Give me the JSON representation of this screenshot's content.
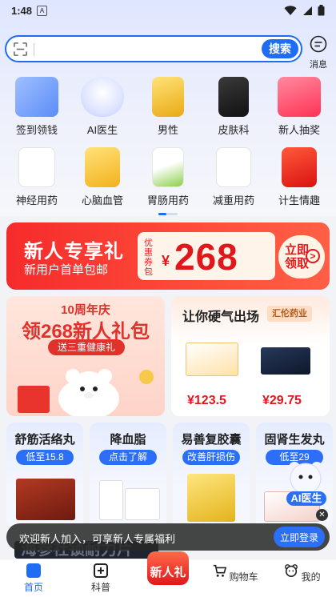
{
  "status": {
    "time": "1:48",
    "app_glyph": "A"
  },
  "search": {
    "placeholder": "",
    "button": "搜索"
  },
  "message": {
    "label": "消息"
  },
  "categories": [
    {
      "label": "签到领钱",
      "icon": "calendar-icon",
      "color": "#6ea0ff"
    },
    {
      "label": "AI医生",
      "icon": "ai-bear-doctor-icon",
      "color": "#cfd8ff"
    },
    {
      "label": "男性",
      "icon": "medicine-box-icon",
      "color": "#f2c230"
    },
    {
      "label": "皮肤科",
      "icon": "medicine-box-icon",
      "color": "#2a2a2a"
    },
    {
      "label": "新人抽奖",
      "icon": "gift-box-icon",
      "color": "#ff4a6a"
    },
    {
      "label": "神经用药",
      "icon": "medicine-box-icon",
      "color": "#ffffff"
    },
    {
      "label": "心脑血管",
      "icon": "medicine-box-icon",
      "color": "#ffcf40"
    },
    {
      "label": "胃肠用药",
      "icon": "medicine-box-icon",
      "color": "#9bd45b"
    },
    {
      "label": "减重用药",
      "icon": "medicine-box-icon",
      "color": "#ffffff"
    },
    {
      "label": "计生情趣",
      "icon": "medicine-box-icon",
      "color": "#e8252a"
    }
  ],
  "banner": {
    "title": "新人专享礼",
    "subtitle": "新用户首单包邮",
    "coupon_label": "优惠券包",
    "currency": "¥",
    "amount": "268",
    "claim": "立即领取"
  },
  "anniversary": {
    "line1": "10周年庆",
    "line2": "领268新人礼包",
    "line3": "送三重健康礼"
  },
  "hard": {
    "title": "让你硬气出场",
    "tag": "汇伦药业",
    "products": [
      {
        "price": "¥123.5",
        "color": "#f3a94a"
      },
      {
        "price": "¥29.75",
        "color": "#1c2a44"
      }
    ]
  },
  "cards": [
    {
      "name": "舒筋活络丸",
      "sub": "低至15.8",
      "color": "#8a2a1c"
    },
    {
      "name": "降血脂",
      "sub": "点击了解",
      "color": "#f1d24a"
    },
    {
      "name": "易善复胶囊",
      "sub": "改善肝损伤",
      "color": "#f2d23a"
    },
    {
      "name": "固肾生发丸",
      "sub": "低至29",
      "color": "#c7372a"
    }
  ],
  "ai_doctor": {
    "label": "AI医生"
  },
  "toast": {
    "text": "欢迎新人加入，可享新人专属福利",
    "button": "立即登录"
  },
  "faint_text": "海参社锁耐力片",
  "nav": [
    {
      "label": "首页",
      "icon": "home-icon"
    },
    {
      "label": "科普",
      "icon": "plus-square-icon"
    },
    {
      "label": "新人礼",
      "icon": "new-gift-icon"
    },
    {
      "label": "购物车",
      "icon": "cart-icon"
    },
    {
      "label": "我的",
      "icon": "bear-profile-icon"
    }
  ]
}
